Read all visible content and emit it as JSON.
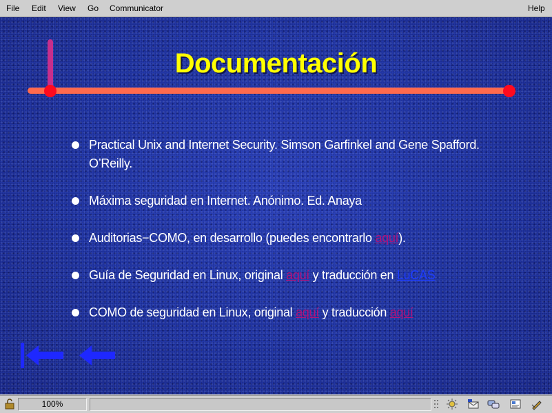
{
  "menubar": {
    "items": [
      "File",
      "Edit",
      "View",
      "Go",
      "Communicator"
    ],
    "help": "Help"
  },
  "page": {
    "title": "Documentación",
    "items": [
      {
        "text": "Practical Unix and Internet Security. Simson Garfinkel and Gene Spafford. O’Reilly."
      },
      {
        "text": "Máxima seguridad en Internet. Anónimo. Ed. Anaya"
      },
      {
        "pre": "Auditorias−COMO, en desarrollo (puedes encontrarlo ",
        "link": "aquí",
        "post": ")."
      },
      {
        "pre": "Guía de Seguridad en Linux, original ",
        "link1": "aquí",
        "mid": " y traducción en ",
        "link2": "LuCAS"
      },
      {
        "pre": "COMO de seguridad en Linux, original ",
        "link1": "aquí",
        "mid": " y traducción ",
        "link2": "aquí"
      }
    ]
  },
  "statusbar": {
    "zoom": "100%"
  },
  "icons": {
    "first": "first-page-arrow-icon",
    "prev": "previous-page-arrow-icon"
  },
  "colors": {
    "title": "#ffff00",
    "link": "#b0127a",
    "link_lucas": "#1d3cff",
    "line": "#ff6a4d",
    "dot": "#ff0a1e",
    "arrow": "#1e28ff"
  }
}
